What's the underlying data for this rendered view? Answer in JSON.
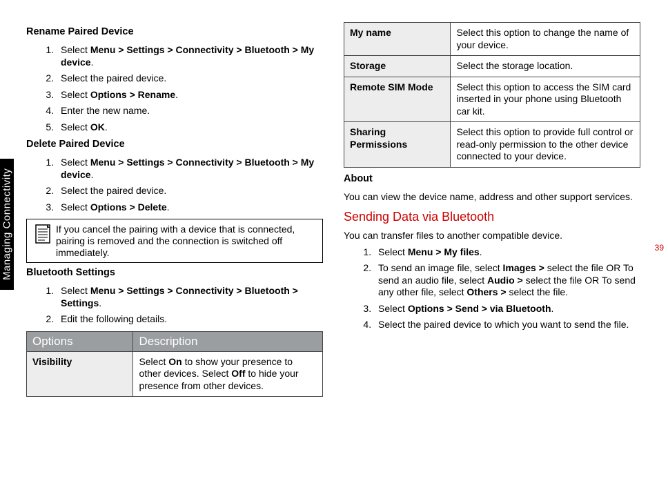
{
  "sideTab": "Managing Connectivity",
  "pageNumber": "39",
  "left": {
    "h1": "Rename Paired Device",
    "s1": {
      "i1a": "Select ",
      "i1b": "Menu > Settings > Connectivity > Bluetooth > My device",
      "i1c": ".",
      "i2": "Select the paired device.",
      "i3a": "Select ",
      "i3b": "Options > Rename",
      "i3c": ".",
      "i4": "Enter the new name.",
      "i5a": "Select ",
      "i5b": "OK",
      "i5c": "."
    },
    "h2": "Delete Paired Device",
    "s2": {
      "i1a": "Select ",
      "i1b": "Menu > Settings > Connectivity > Bluetooth > My device",
      "i1c": ".",
      "i2": "Select the paired device.",
      "i3a": "Select ",
      "i3b": "Options > Delete",
      "i3c": "."
    },
    "note": "If you cancel the pairing with a device that is connected, pairing is removed and the connection is switched off immediately.",
    "h3": "Bluetooth Settings",
    "s3": {
      "i1a": "Select ",
      "i1b": "Menu > Settings > Connectivity > Bluetooth > Settings",
      "i1c": ".",
      "i2": "Edit the following details."
    },
    "tableHead": {
      "c1": "Options",
      "c2": "Description"
    },
    "row1": {
      "name": "Visibility",
      "d1": "Select ",
      "d2": "On",
      "d3": " to show your presence to other devices. Select ",
      "d4": "Off",
      "d5": " to hide your presence from other devices."
    }
  },
  "right": {
    "rows": {
      "r1": {
        "name": "My name",
        "desc": "Select this option to change the name of your device."
      },
      "r2": {
        "name": "Storage",
        "desc": "Select the storage location."
      },
      "r3": {
        "name": "Remote SIM Mode",
        "desc": "Select this option to access the SIM card inserted in your phone using Bluetooth car kit."
      },
      "r4": {
        "name": "Sharing Permissions",
        "desc": "Select this option to provide full control or read-only permission to the other device connected to your device."
      }
    },
    "h1": "About",
    "p1": "You can view the device name, address and other support services.",
    "h2": "Sending Data via Bluetooth",
    "p2": "You can transfer files to another compatible device.",
    "steps": {
      "i1a": "Select ",
      "i1b": "Menu > My files",
      "i1c": ".",
      "i2a": "To send an image file, select ",
      "i2b": "Images >",
      "i2c": " select the file OR To send an audio file, select ",
      "i2d": "Audio >",
      "i2e": " select the file OR To send any other file, select ",
      "i2f": "Others >",
      "i2g": " select the file.",
      "i3a": "Select ",
      "i3b": "Options > Send > via Bluetooth",
      "i3c": ".",
      "i4": "Select the paired device to which you want to send the file."
    }
  }
}
